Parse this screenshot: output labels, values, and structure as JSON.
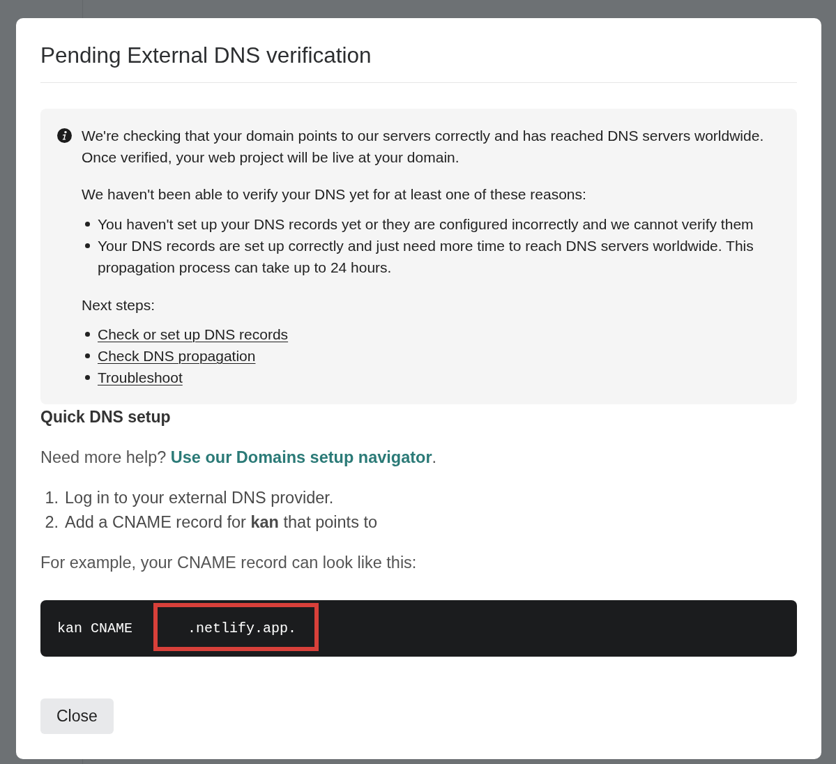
{
  "dialog": {
    "title": "Pending External DNS verification",
    "notice": {
      "paragraphs": [
        "We're checking that your domain points to our servers correctly and has reached DNS servers worldwide. Once verified, your web project will be live at your domain.",
        "We haven't been able to verify your DNS yet for at least one of these reasons:"
      ],
      "reasons": [
        "You haven't set up your DNS records yet or they are configured incorrectly and we cannot verify them",
        "Your DNS records are set up correctly and just need more time to reach DNS servers worldwide. This propagation process can take up to 24 hours."
      ],
      "next_steps_label": "Next steps:",
      "next_steps": [
        {
          "label": "Check or set up DNS records"
        },
        {
          "label": "Check DNS propagation"
        },
        {
          "label": "Troubleshoot"
        }
      ]
    },
    "quick_setup": {
      "heading": "Quick DNS setup",
      "help": {
        "text": "Need more help?",
        "link": "Use our Domains setup navigator",
        "end": "."
      },
      "steps": [
        {
          "number": "1.",
          "text": "Log in to your external DNS provider."
        },
        {
          "number": "2.",
          "text": "Add a CNAME record for **kan** that points to"
        }
      ],
      "example_intro": "For example, your CNAME record can look like this:",
      "example_record": {
        "name": "kan",
        "type": "CNAME",
        "target": ".netlify.app.",
        "highlighted": true
      }
    },
    "buttons": [
      {
        "label": "Close"
      }
    ]
  }
}
